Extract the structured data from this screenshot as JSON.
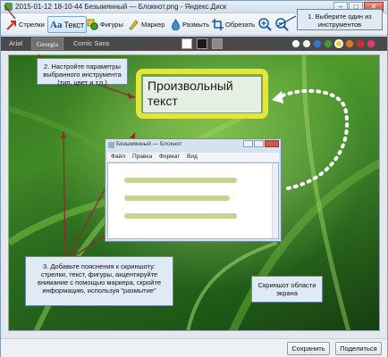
{
  "window": {
    "title": "2015-01-12 18-10-44 Безымянный — Блокнот.png - Яндекс.Диск"
  },
  "toolbar": {
    "tools": [
      {
        "label": "Стрелки",
        "icon": "arrow-icon"
      },
      {
        "label": "Текст",
        "icon": "text-icon"
      },
      {
        "label": "Фигуры",
        "icon": "shapes-icon"
      },
      {
        "label": "Маркер",
        "icon": "marker-icon"
      },
      {
        "label": "Размыть",
        "icon": "blur-icon"
      },
      {
        "label": "Обрезать",
        "icon": "crop-icon"
      }
    ],
    "active_tool": "Текст"
  },
  "format_bar": {
    "fonts": [
      "Arial",
      "Georgia",
      "Comic Sans"
    ],
    "selected_font": "Georgia",
    "colors": [
      "#ffffff",
      "#000000",
      "#8a8a8a",
      "#f0f0f0",
      "#2a7ad8",
      "#3f9d2f",
      "#e8d21f",
      "#e07a1a",
      "#d8292a",
      "#e6377b"
    ],
    "selected_color": "#e8d21f"
  },
  "callouts": {
    "tools_hint": "1. Выберите один из инструментов",
    "params_hint": "2. Настройте параметры выбранного инструмента (тип, цвет и т.п.)",
    "annotations_hint": "3. Добавьте пояснения к скриншоту: стрелки, текст, фигуры, акцентируйте внимание с помощью маркера, скройте информацию, используя \"размытие\"",
    "area_hint": "Скриншот области экрана"
  },
  "canvas": {
    "big_text": "Произвольный текст",
    "notepad": {
      "title": "Безымянный — Блокнот",
      "menu": [
        "Файл",
        "Правка",
        "Формат",
        "Вид"
      ]
    }
  },
  "actions": {
    "save": "Сохранить",
    "share": "Поделиться"
  }
}
